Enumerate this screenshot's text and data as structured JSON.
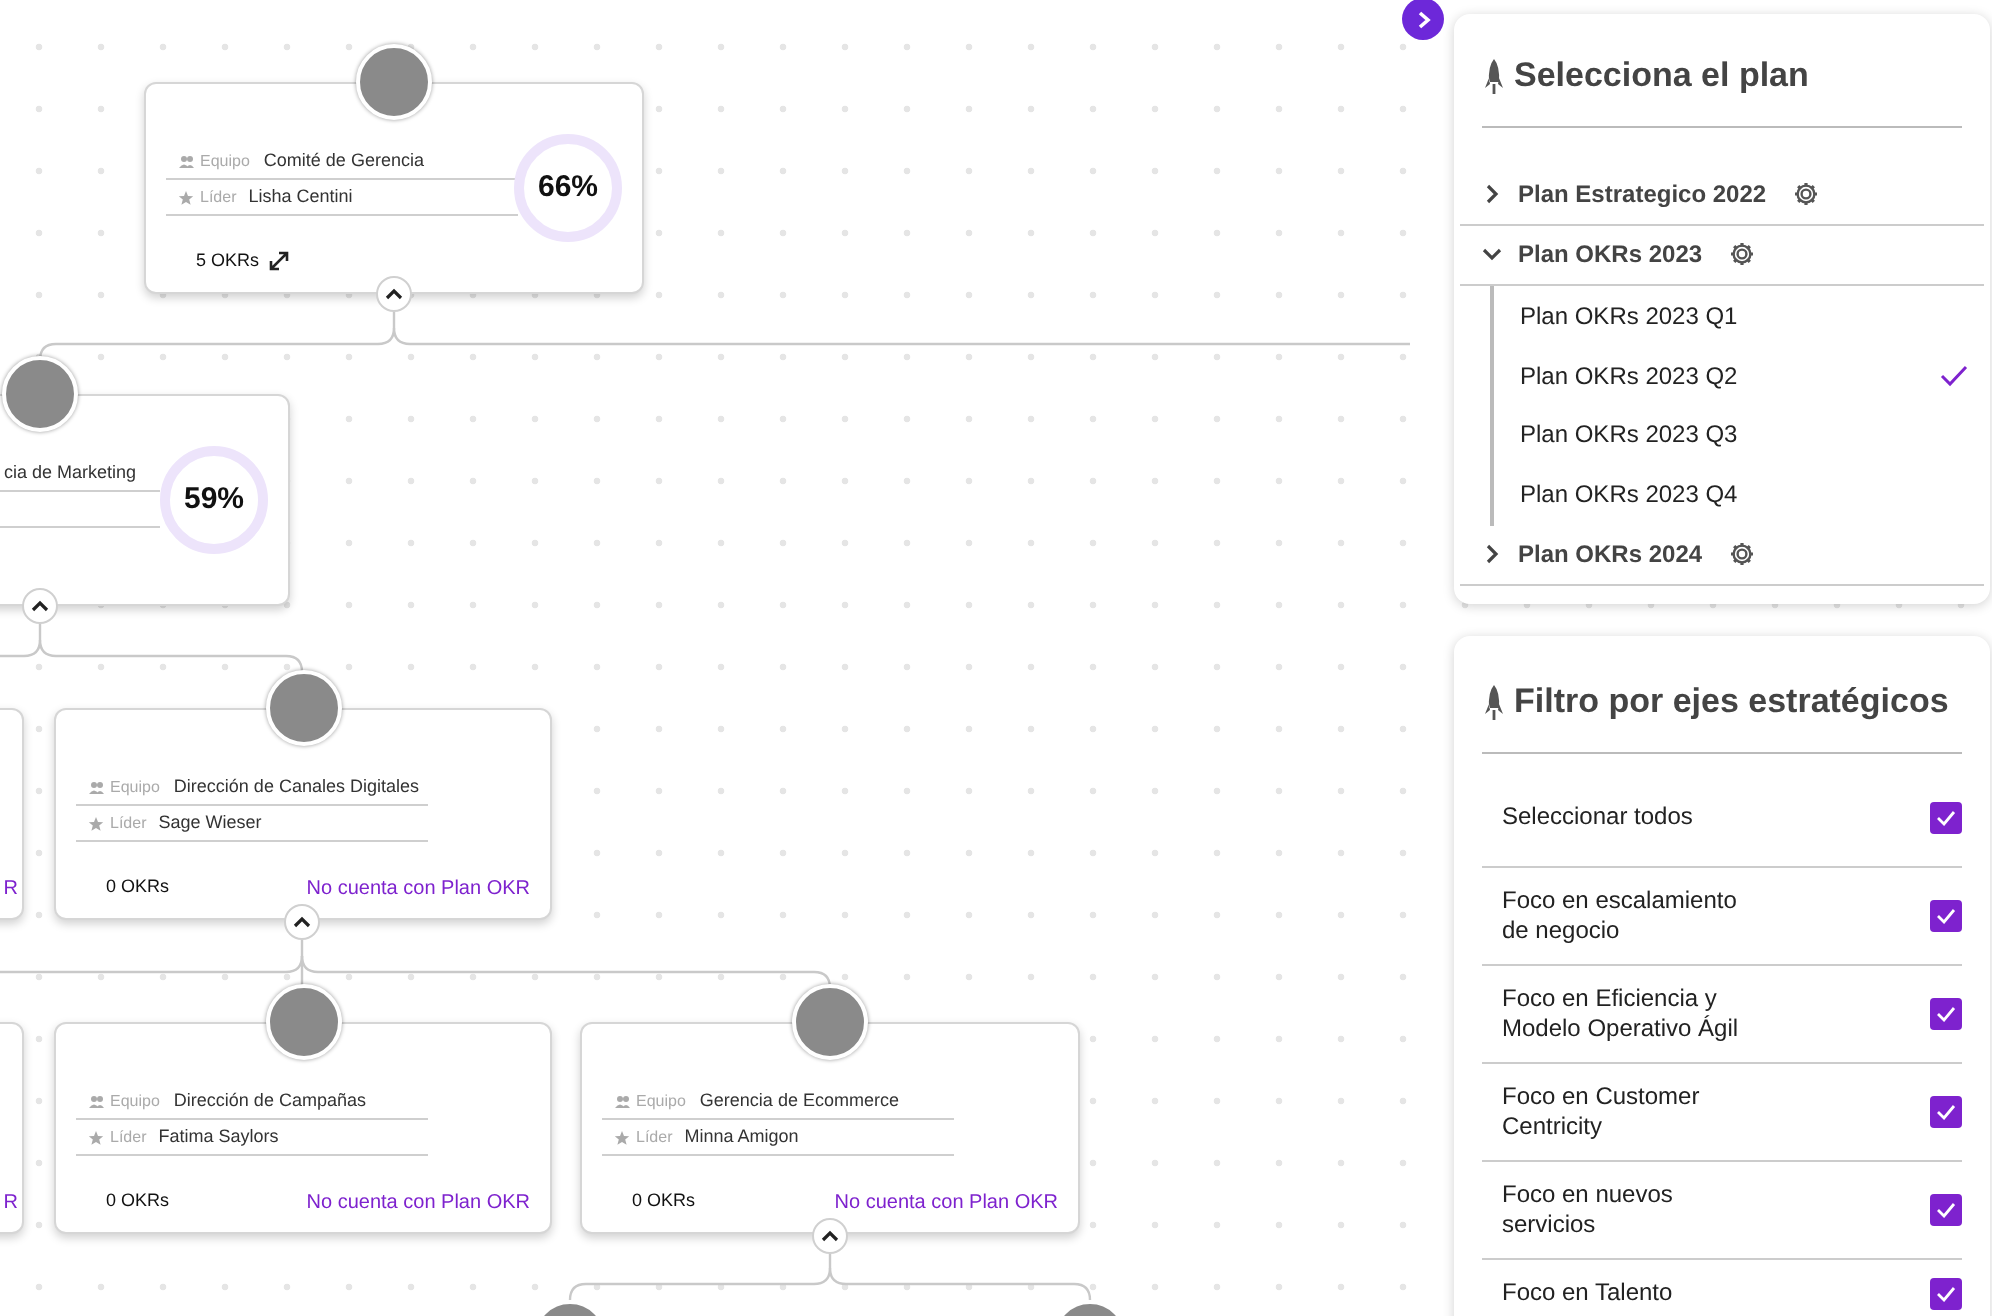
{
  "org_chart": {
    "nodes": [
      {
        "kind": "full",
        "team_label": "Equipo",
        "team": "Comité de Gerencia",
        "leader_label": "Líder",
        "leader": "Lisha Centini",
        "okrs": "5 OKRs",
        "expand": true,
        "progress": "66%"
      },
      {
        "kind": "cut",
        "team": "cia de Marketing",
        "progress": "59%"
      },
      {
        "kind": "edge",
        "note": "R"
      },
      {
        "kind": "full",
        "team_label": "Equipo",
        "team": "Dirección de Canales Digitales",
        "leader_label": "Líder",
        "leader": "Sage Wieser",
        "okrs": "0 OKRs",
        "note": "No cuenta con Plan OKR"
      },
      {
        "kind": "edge",
        "note": "R"
      },
      {
        "kind": "full",
        "team_label": "Equipo",
        "team": "Dirección de Campañas",
        "leader_label": "Líder",
        "leader": "Fatima Saylors",
        "okrs": "0 OKRs",
        "note": "No cuenta con Plan OKR"
      },
      {
        "kind": "full",
        "team_label": "Equipo",
        "team": "Gerencia de Ecommerce",
        "leader_label": "Líder",
        "leader": "Minna Amigon",
        "okrs": "0 OKRs",
        "note": "No cuenta con Plan OKR"
      }
    ]
  },
  "plan_panel": {
    "title": "Selecciona el plan",
    "plans": [
      {
        "label": "Plan Estrategico 2022",
        "expanded": false
      },
      {
        "label": "Plan OKRs 2023",
        "expanded": true,
        "children": [
          {
            "label": "Plan OKRs 2023 Q1",
            "selected": false
          },
          {
            "label": "Plan OKRs 2023 Q2",
            "selected": true
          },
          {
            "label": "Plan OKRs 2023 Q3",
            "selected": false
          },
          {
            "label": "Plan OKRs 2023 Q4",
            "selected": false
          }
        ]
      },
      {
        "label": "Plan OKRs 2024",
        "expanded": false
      }
    ]
  },
  "filter_panel": {
    "title": "Filtro por ejes estratégicos",
    "items": [
      {
        "label": "Seleccionar todos",
        "checked": true
      },
      {
        "label": "Foco en escalamiento de negocio",
        "checked": true
      },
      {
        "label": "Foco en Eficiencia y Modelo Operativo Ágil",
        "checked": true
      },
      {
        "label": "Foco en Customer Centricity",
        "checked": true
      },
      {
        "label": "Foco en nuevos servicios",
        "checked": true
      },
      {
        "label": "Foco en Talento",
        "checked": true
      }
    ]
  }
}
